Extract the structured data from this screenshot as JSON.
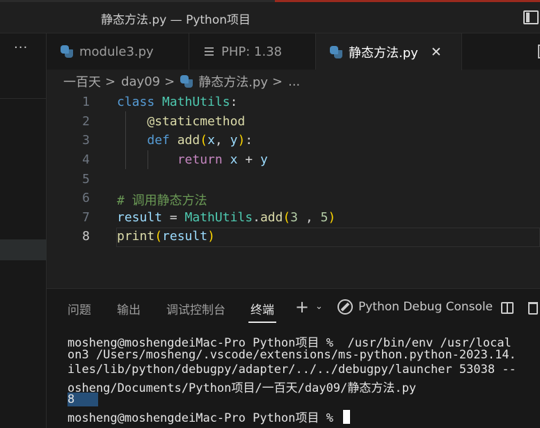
{
  "window": {
    "title": "静态方法.py — Python项目"
  },
  "sidebar": {
    "more_label": "···"
  },
  "tabs": [
    {
      "label": "module3.py",
      "icon": "python-icon"
    },
    {
      "label": "PHP: 1.38",
      "icon": "lines-icon"
    },
    {
      "label": "静态方法.py",
      "icon": "python-icon",
      "active": true
    }
  ],
  "breadcrumb": {
    "parts": [
      "一百天",
      "day09",
      "静态方法.py",
      "..."
    ],
    "separator": ">"
  },
  "editor": {
    "line_numbers": [
      "1",
      "2",
      "3",
      "4",
      "5",
      "6",
      "7",
      "8"
    ],
    "active_line": "8",
    "lines": {
      "l1_kw": "class",
      "l1_cls": "MathUtils",
      "l1_colon": ":",
      "l2_dec": "@staticmethod",
      "l3_kw": "def",
      "l3_fn": "add",
      "l3_open": "(",
      "l3_x": "x",
      "l3_comma": ", ",
      "l3_y": "y",
      "l3_close": ")",
      "l3_colon": ":",
      "l4_kw": "return",
      "l4_x": "x",
      "l4_op": " + ",
      "l4_y": "y",
      "l6_cmt": "# 调用静态方法",
      "l7_var": "result",
      "l7_eq": " = ",
      "l7_cls": "MathUtils",
      "l7_dot": ".",
      "l7_fn": "add",
      "l7_open": "(",
      "l7_a": "3",
      "l7_comma": " , ",
      "l7_b": "5",
      "l7_close": ")",
      "l8_fn": "print",
      "l8_open": "(",
      "l8_arg": "result",
      "l8_close": ")"
    }
  },
  "panel": {
    "tabs": [
      "问题",
      "输出",
      "调试控制台",
      "终端"
    ],
    "active_tab": "终端",
    "console_label": "Python Debug Console"
  },
  "terminal": {
    "lines": [
      "mosheng@moshengdeiMac-Pro Python项目 %  /usr/bin/env /usr/local",
      "on3 /Users/mosheng/.vscode/extensions/ms-python.python-2023.14.",
      "iles/lib/python/debugpy/adapter/../../debugpy/launcher 53038 --",
      "osheng/Documents/Python项目/一百天/day09/静态方法.py"
    ],
    "output": "8",
    "prompt": "mosheng@moshengdeiMac-Pro Python项目 % "
  },
  "colors": {
    "keyword": "#569cd6",
    "class": "#4ec9b0",
    "function": "#dcdcaa",
    "variable": "#9cdcfe",
    "number": "#b5cea8",
    "comment": "#6a9955",
    "control": "#c586c0",
    "selection": "#264f78",
    "accent_red": "#9a2a1e"
  }
}
